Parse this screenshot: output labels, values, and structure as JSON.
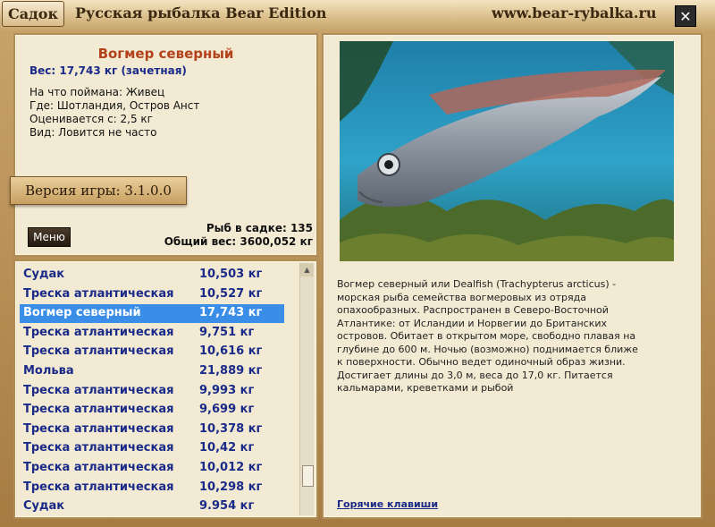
{
  "titlebar": {
    "tab_label": "Садок",
    "app_title": "Русская рыбалка Bear Edition",
    "site_url": "www.bear-rybalka.ru",
    "close_label": "✕"
  },
  "fish_info": {
    "name": "Вогмер северный",
    "weight_line": "Вес: 17,743 кг (зачетная)",
    "bait_line": "На что поймана: Живец",
    "place_line": "Где: Шотландия, Остров Анст",
    "rated_line": "Оценивается с: 2,5 кг",
    "kind_line": "Вид: Ловится не часто"
  },
  "version": "Версия игры: 3.1.0.0",
  "menu_label": "Меню",
  "summary": {
    "fish_count": "Рыб в садке: 135",
    "total_weight": "Общий вес: 3600,052 кг"
  },
  "catch_list": [
    {
      "name": "Судак",
      "weight": "10,503 кг"
    },
    {
      "name": "Треска атлантическая",
      "weight": "10,527 кг"
    },
    {
      "name": "Вогмер северный",
      "weight": "17,743 кг",
      "selected": true
    },
    {
      "name": "Треска атлантическая",
      "weight": "9,751 кг"
    },
    {
      "name": "Треска атлантическая",
      "weight": "10,616 кг"
    },
    {
      "name": "Мольва",
      "weight": "21,889 кг"
    },
    {
      "name": "Треска атлантическая",
      "weight": "9,993 кг"
    },
    {
      "name": "Треска атлантическая",
      "weight": "9,699 кг"
    },
    {
      "name": "Треска атлантическая",
      "weight": "10,378 кг"
    },
    {
      "name": "Треска атлантическая",
      "weight": "10,42 кг"
    },
    {
      "name": "Треска атлантическая",
      "weight": "10,012 кг"
    },
    {
      "name": "Треска атлантическая",
      "weight": "10,298 кг"
    },
    {
      "name": "Судак",
      "weight": "9.954 кг"
    }
  ],
  "description": "Вогмер северный или Dealfish (Trachypterus arcticus) - морская рыба семейства вогмеровых из отряда опахообразных. Распространен в Северо-Восточной Атлантике: от Исландии и Норвегии до Британских островов. Обитает в открытом море, свободно плавая на глубине до 600 м. Ночью (возможно) поднимается ближе к поверхности. Обычно ведет одиночный образ жизни. Достигает длины до 3,0 м, веса до 17,0 кг. Питается кальмарами, креветками и рыбой",
  "hotkeys_label": "Горячие клавиши",
  "colors": {
    "selected_row": "#3b8ee8",
    "list_text": "#1a2a88",
    "fish_title": "#b3411a",
    "panel_bg": "#f2ead3"
  }
}
